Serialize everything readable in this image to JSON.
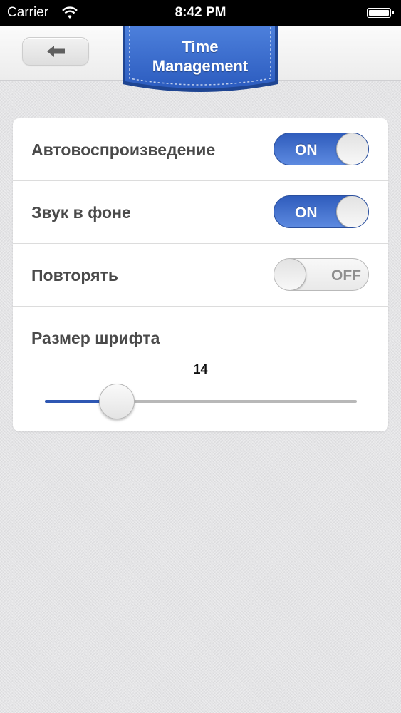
{
  "status_bar": {
    "carrier": "Carrier",
    "time": "8:42 PM"
  },
  "nav": {
    "back_icon": "back-arrow-icon",
    "title_line1": "Time",
    "title_line2": "Management",
    "badge_color": "#3b6fce"
  },
  "settings": {
    "rows": [
      {
        "label": "Автовоспроизведение",
        "toggle": "ON",
        "state": true
      },
      {
        "label": "Звук в фоне",
        "toggle": "ON",
        "state": true
      },
      {
        "label": "Повторять",
        "toggle": "OFF",
        "state": false
      }
    ],
    "font_size": {
      "label": "Размер шрифта",
      "value": "14",
      "slider_fraction": 0.23
    }
  },
  "colors": {
    "accent": "#2f5cbc",
    "background": "#e4e4e6"
  }
}
